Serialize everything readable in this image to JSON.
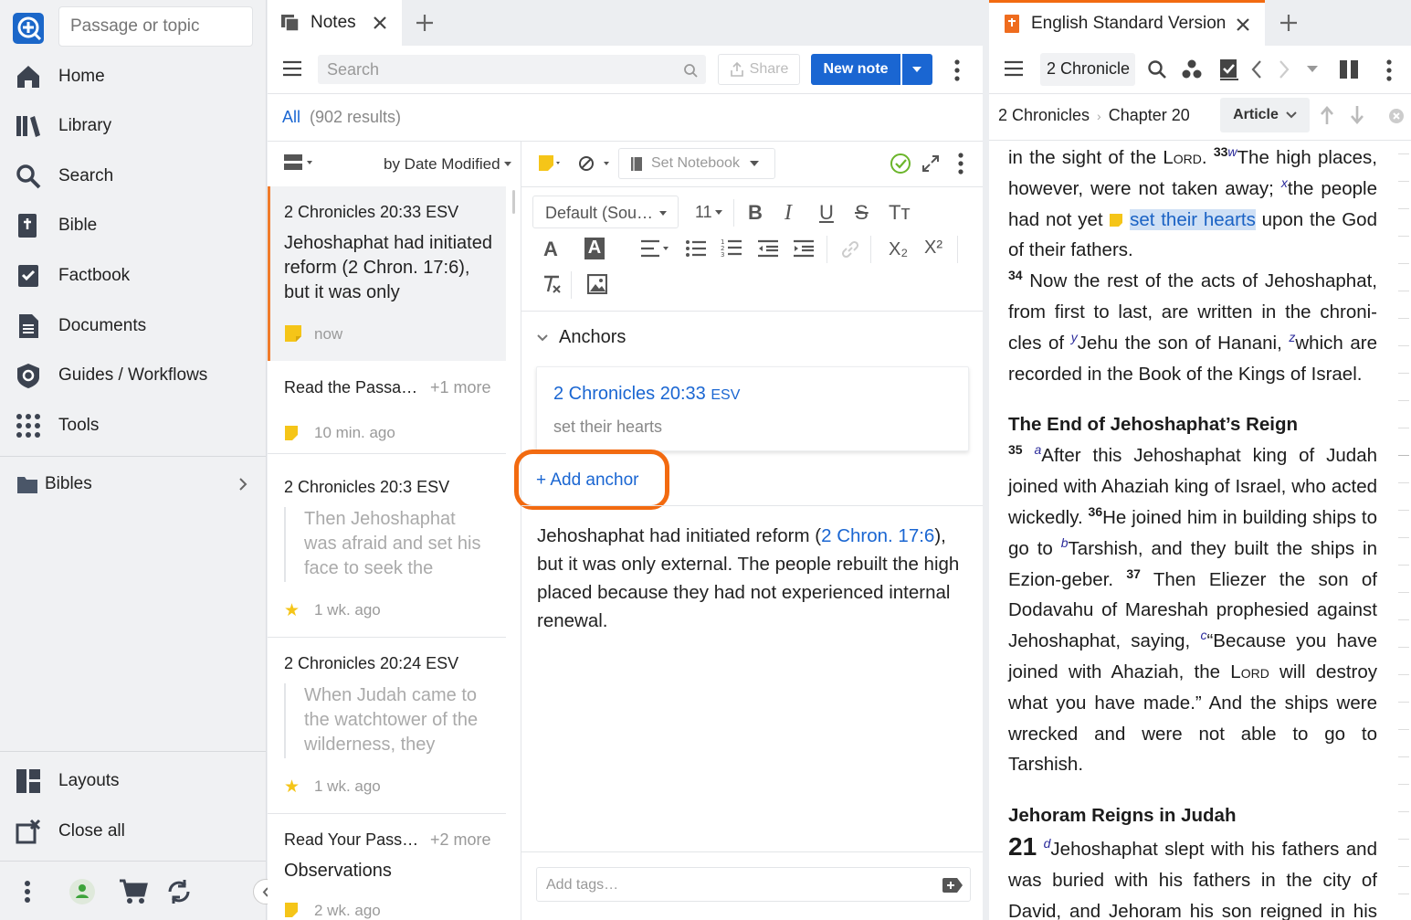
{
  "sidebar": {
    "passage_placeholder": "Passage or topic",
    "items": [
      {
        "label": "Home"
      },
      {
        "label": "Library"
      },
      {
        "label": "Search"
      },
      {
        "label": "Bible"
      },
      {
        "label": "Factbook"
      },
      {
        "label": "Documents"
      },
      {
        "label": "Guides / Workflows"
      },
      {
        "label": "Tools"
      }
    ],
    "bibles_label": "Bibles",
    "bottom_items": [
      {
        "label": "Layouts"
      },
      {
        "label": "Close all"
      }
    ]
  },
  "notes_tab": {
    "title": "Notes",
    "search_placeholder": "Search",
    "share_label": "Share",
    "new_note_label": "New note",
    "filter_label": "All",
    "results": "(902 results)",
    "sort_label": "by Date Modified",
    "items": [
      {
        "title": "2 Chronicles 20:33 ESV",
        "body": "Jehoshaphat had initiated reform (2 Chron. 17:6), but it was only",
        "time": "now",
        "selected": true
      },
      {
        "title": "Read the Passa…",
        "extra": "+1 more",
        "time": "10 min. ago"
      },
      {
        "title": "2 Chronicles 20:3 ESV",
        "quote": "Then Jehoshaphat was afraid and set his face to seek the LORD,",
        "time": "1 wk. ago"
      },
      {
        "title": "2 Chronicles 20:24 ESV",
        "quote": "When Judah came to the watchtower of the wilderness, they",
        "time": "1 wk. ago"
      },
      {
        "title": "Read Your Pass…",
        "extra": "+2 more",
        "subtitle": "Observations",
        "time": "2 wk. ago"
      }
    ],
    "editor": {
      "notebook_label": "Set Notebook",
      "font_family": "Default (Sou…",
      "font_size": "11",
      "anchors_heading": "Anchors",
      "anchor_ref": "2 Chronicles 20:33",
      "anchor_version": "ESV",
      "anchor_text": "set their hearts",
      "add_anchor_label": "+ Add anchor",
      "content_before": "Jehoshaphat had initiated reform (",
      "content_link": "2 Chron. 17:6",
      "content_after": "), but it was only external. The people rebuilt the high placed because they had not experienced internal renewal.",
      "tags_placeholder": "Add tags…"
    }
  },
  "bible_tab": {
    "title": "English Standard Version",
    "reference_box": "2 Chronicle",
    "breadcrumb_book": "2 Chronicles",
    "breadcrumb_chapter": "Chapter 20",
    "article_label": "Article",
    "heading1": "The End of Jehoshaphat’s Reign",
    "heading2": "Jehoram Reigns in Judah"
  },
  "colors": {
    "accent": "#1a66d2",
    "highlight_orange": "#f26a10",
    "note_yellow": "#f5c518",
    "selected_border": "#f07b2a"
  }
}
